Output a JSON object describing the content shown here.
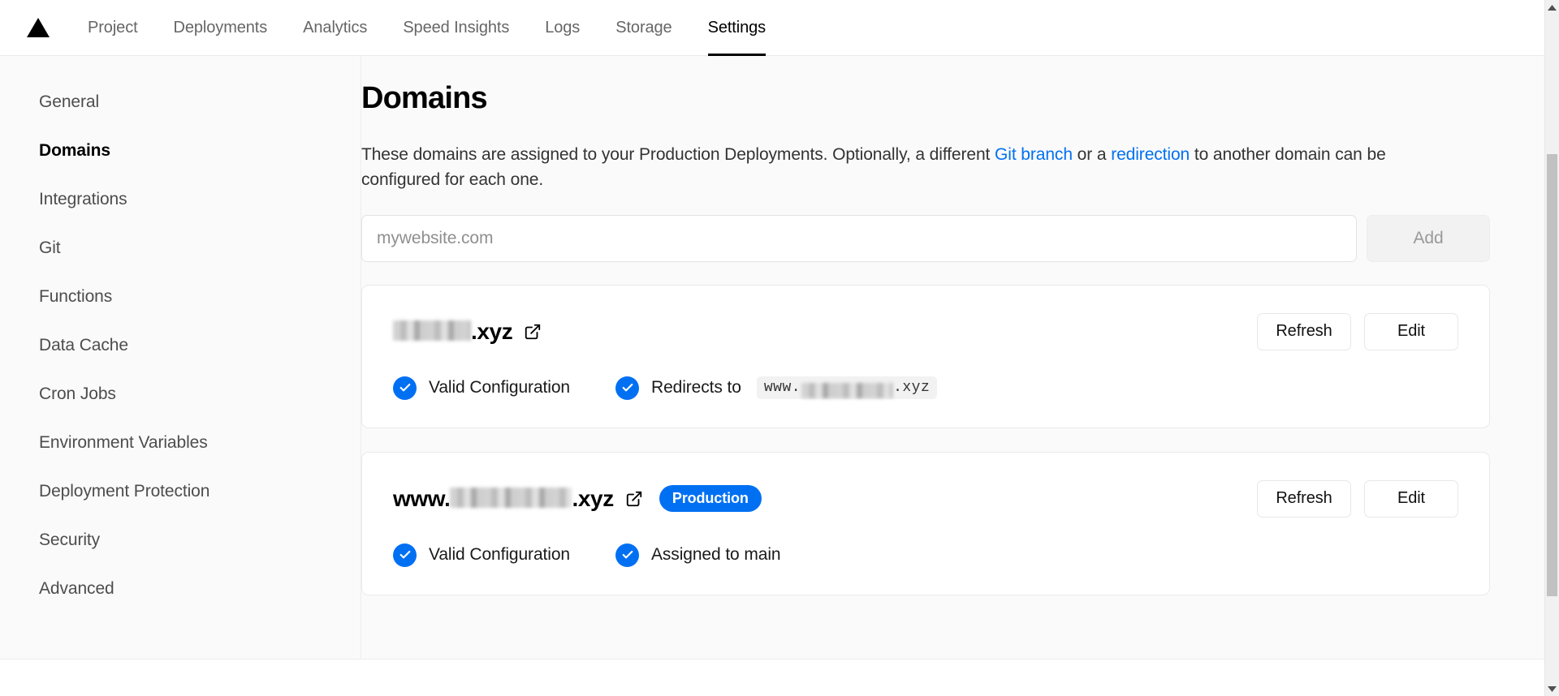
{
  "topnav": {
    "logo_icon": "vercel-triangle-logo",
    "tabs": [
      {
        "label": "Project",
        "active": false
      },
      {
        "label": "Deployments",
        "active": false
      },
      {
        "label": "Analytics",
        "active": false
      },
      {
        "label": "Speed Insights",
        "active": false
      },
      {
        "label": "Logs",
        "active": false
      },
      {
        "label": "Storage",
        "active": false
      },
      {
        "label": "Settings",
        "active": true
      }
    ]
  },
  "sidebar": {
    "items": [
      {
        "label": "General",
        "active": false
      },
      {
        "label": "Domains",
        "active": true
      },
      {
        "label": "Integrations",
        "active": false
      },
      {
        "label": "Git",
        "active": false
      },
      {
        "label": "Functions",
        "active": false
      },
      {
        "label": "Data Cache",
        "active": false
      },
      {
        "label": "Cron Jobs",
        "active": false
      },
      {
        "label": "Environment Variables",
        "active": false
      },
      {
        "label": "Deployment Protection",
        "active": false
      },
      {
        "label": "Security",
        "active": false
      },
      {
        "label": "Advanced",
        "active": false
      }
    ]
  },
  "main": {
    "title": "Domains",
    "description": {
      "part1": "These domains are assigned to your Production Deployments. Optionally, a different ",
      "link1": "Git branch",
      "part2": " or a ",
      "link2": "redirection",
      "part3": " to another domain can be configured for each one."
    },
    "add_form": {
      "input_placeholder": "mywebsite.com",
      "input_value": "",
      "add_label": "Add"
    },
    "domains": [
      {
        "name_prefix": "",
        "name_redacted": true,
        "name_suffix": ".xyz",
        "external_link_icon": "external-link-icon",
        "badge": null,
        "refresh_label": "Refresh",
        "edit_label": "Edit",
        "statuses": [
          {
            "icon": "check-circle-icon",
            "label": "Valid Configuration",
            "code": null
          },
          {
            "icon": "check-circle-icon",
            "label": "Redirects to",
            "code_prefix": "www.",
            "code_redacted": true,
            "code_suffix": ".xyz"
          }
        ]
      },
      {
        "name_prefix": "www.",
        "name_redacted": true,
        "name_suffix": ".xyz",
        "external_link_icon": "external-link-icon",
        "badge": "Production",
        "refresh_label": "Refresh",
        "edit_label": "Edit",
        "statuses": [
          {
            "icon": "check-circle-icon",
            "label": "Valid Configuration",
            "code": null
          },
          {
            "icon": "check-circle-icon",
            "label": "Assigned to main",
            "code": null
          }
        ]
      }
    ]
  },
  "scrollbar": {
    "up_icon": "scroll-up-arrow-icon",
    "down_icon": "scroll-down-arrow-icon"
  },
  "colors": {
    "accent": "#0070f3",
    "text": "#000000",
    "muted": "#666666",
    "page_bg": "#fafafa",
    "card_bg": "#ffffff",
    "border": "#eaeaea"
  }
}
